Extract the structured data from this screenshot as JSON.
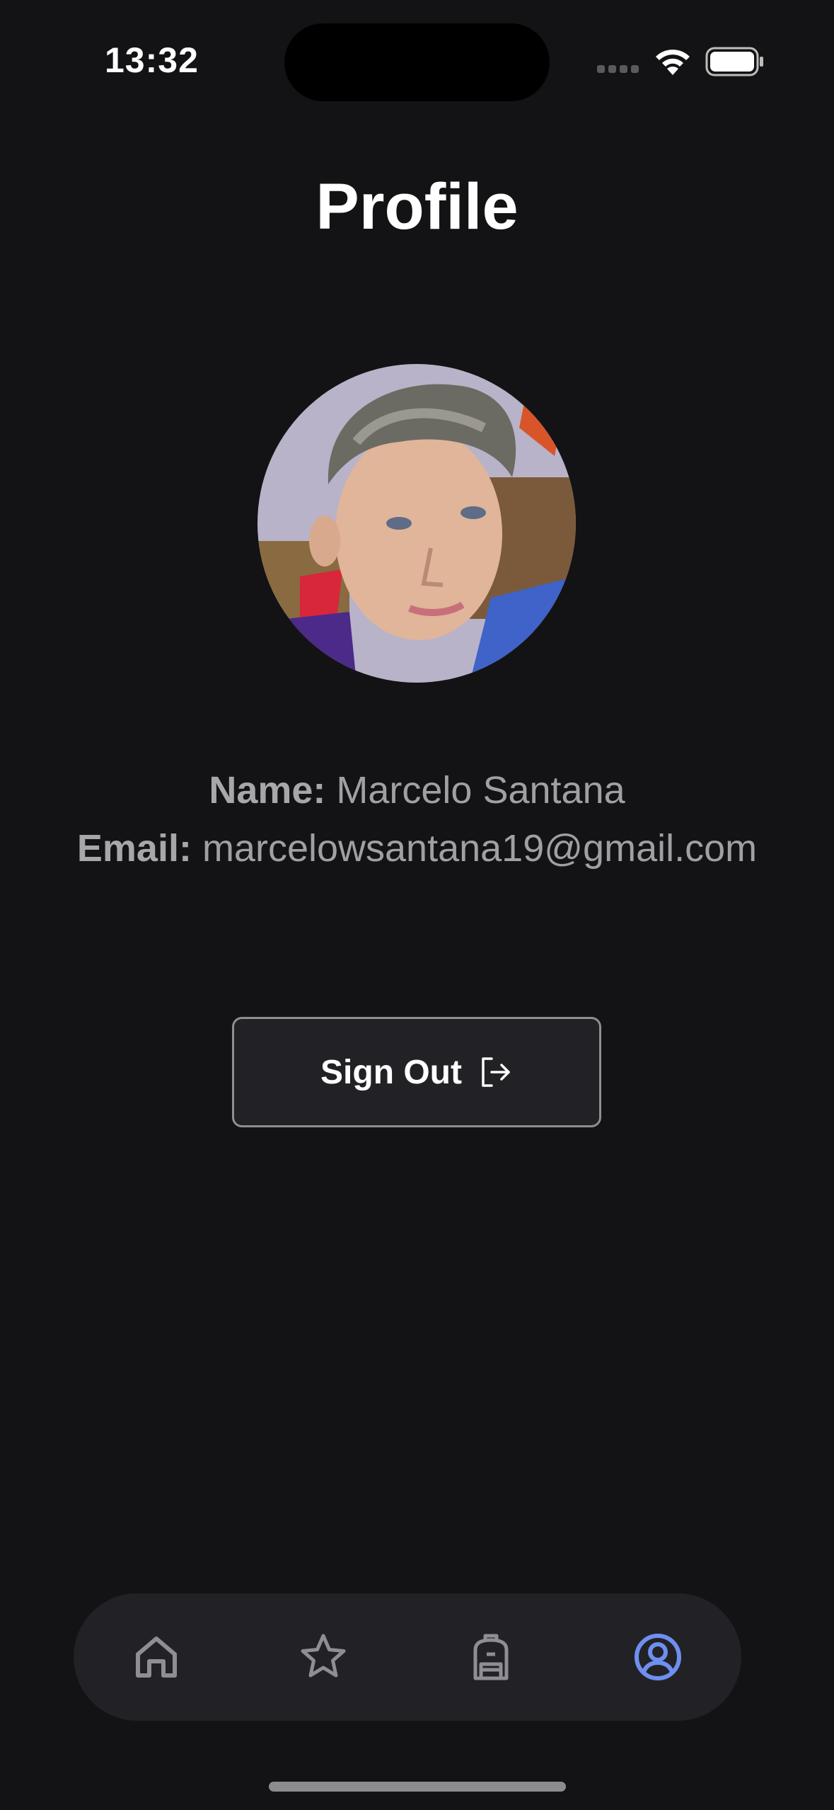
{
  "status_bar": {
    "time": "13:32"
  },
  "page": {
    "title": "Profile"
  },
  "profile": {
    "name_label": "Name:",
    "name_value": "Marcelo Santana",
    "email_label": "Email:",
    "email_value": "marcelowsantana19@gmail.com"
  },
  "actions": {
    "sign_out_label": "Sign Out",
    "sign_out_icon": "sign-out-icon"
  },
  "tab_bar": {
    "tabs": [
      {
        "icon": "home-icon",
        "active": false
      },
      {
        "icon": "star-icon",
        "active": false
      },
      {
        "icon": "backpack-icon",
        "active": false
      },
      {
        "icon": "profile-icon",
        "active": true
      }
    ],
    "active_color": "#6f8ff0",
    "inactive_color": "#8e8e93"
  },
  "colors": {
    "background": "#131315",
    "surface": "#222226",
    "text_secondary": "#a0a0a4"
  }
}
